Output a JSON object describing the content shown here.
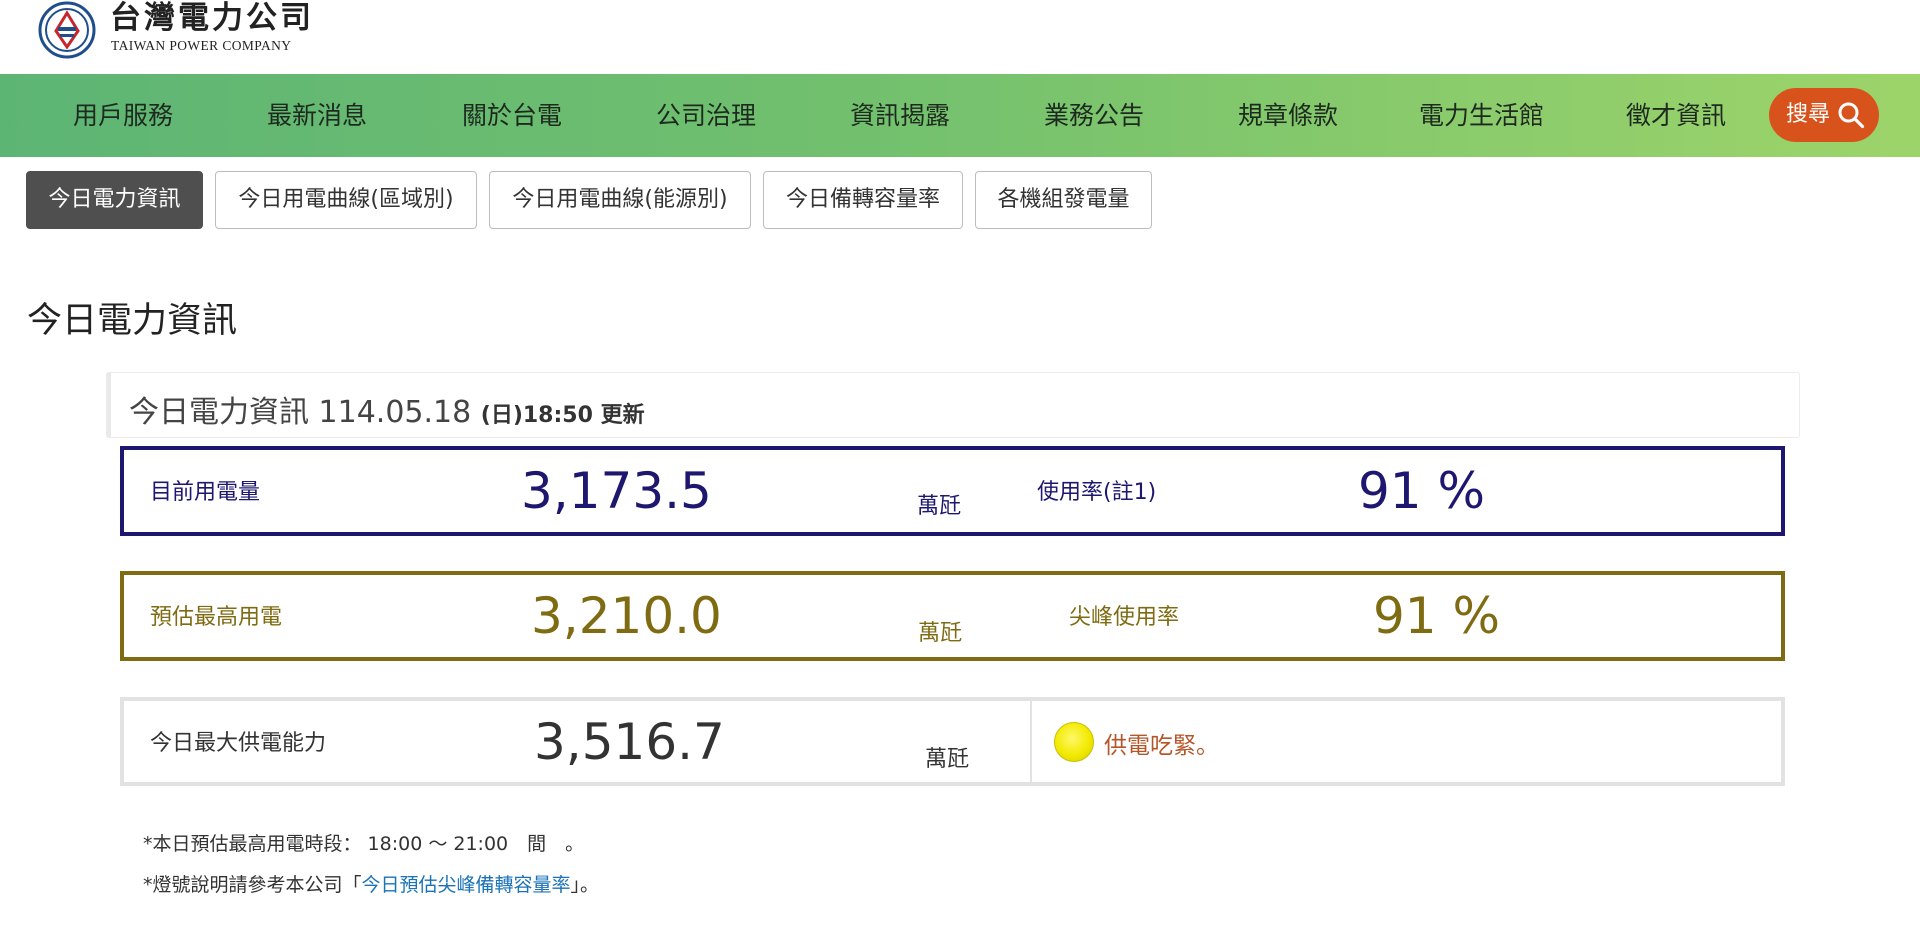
{
  "header": {
    "logo_cn": "台灣電力公司",
    "logo_en": "TAIWAN POWER COMPANY"
  },
  "nav": {
    "items": [
      "用戶服務",
      "最新消息",
      "關於台電",
      "公司治理",
      "資訊揭露",
      "業務公告",
      "規章條款",
      "電力生活館",
      "徵才資訊"
    ],
    "search_label": "搜尋"
  },
  "tabs": [
    {
      "label": "今日電力資訊",
      "active": true
    },
    {
      "label": "今日用電曲線(區域別)",
      "active": false
    },
    {
      "label": "今日用電曲線(能源別)",
      "active": false
    },
    {
      "label": "今日備轉容量率",
      "active": false
    },
    {
      "label": "各機組發電量",
      "active": false
    }
  ],
  "page_title": "今日電力資訊",
  "panel": {
    "title": "今日電力資訊 114.05.18",
    "update_time": "(日)18:50 更新",
    "current": {
      "label": "目前用電量",
      "value": "3,173.5",
      "unit": "萬瓩",
      "rate_label": "使用率(註1)",
      "rate_value": "91 %",
      "color": "#1d1770"
    },
    "forecast": {
      "label": "預估最高用電",
      "value": "3,210.0",
      "unit": "萬瓩",
      "rate_label": "尖峰使用率",
      "rate_value": "91 %",
      "color": "#7e6b12"
    },
    "capacity": {
      "label": "今日最大供電能力",
      "value": "3,516.7",
      "unit": "萬瓩",
      "status_icon": "yellow-light-icon",
      "status_text": "供電吃緊。",
      "status_color": "#b5562a"
    }
  },
  "notes": {
    "peak_period": "*本日預估最高用電時段： 18:00 ～ 21:00　間　。",
    "light_prefix": "*燈號說明請參考本公司「",
    "light_link": "今日預估尖峰備轉容量率",
    "light_suffix": "」。"
  }
}
